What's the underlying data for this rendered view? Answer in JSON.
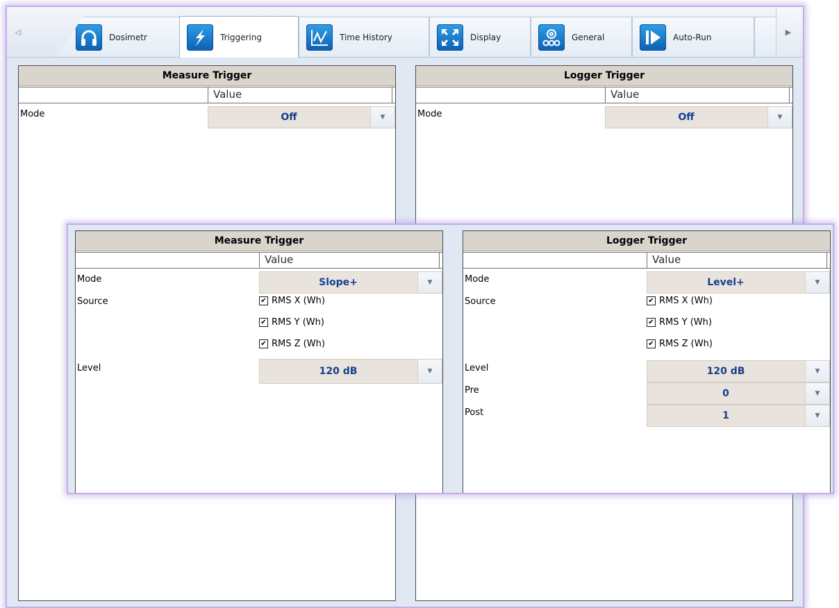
{
  "tabs": [
    {
      "label": "Dosimetr",
      "icon": "headphones-icon"
    },
    {
      "label": "Triggering",
      "icon": "lightning-icon",
      "active": true
    },
    {
      "label": "Time History",
      "icon": "line-chart-icon"
    },
    {
      "label": "Display",
      "icon": "expand-arrows-icon"
    },
    {
      "label": "General",
      "icon": "gears-icon"
    },
    {
      "label": "Auto-Run",
      "icon": "play-icon"
    }
  ],
  "back_panel": {
    "measure": {
      "title": "Measure Trigger",
      "value_header": "Value",
      "mode_label": "Mode",
      "mode_value": "Off"
    },
    "logger": {
      "title": "Logger Trigger",
      "value_header": "Value",
      "mode_label": "Mode",
      "mode_value": "Off"
    }
  },
  "front_panel": {
    "measure": {
      "title": "Measure Trigger",
      "value_header": "Value",
      "mode_label": "Mode",
      "mode_value": "Slope+",
      "source_label": "Source",
      "sources": [
        "RMS X (Wh)",
        "RMS Y (Wh)",
        "RMS Z (Wh)"
      ],
      "level_label": "Level",
      "level_value": "120 dB"
    },
    "logger": {
      "title": "Logger Trigger",
      "value_header": "Value",
      "mode_label": "Mode",
      "mode_value": "Level+",
      "source_label": "Source",
      "sources": [
        "RMS X (Wh)",
        "RMS Y (Wh)",
        "RMS Z (Wh)"
      ],
      "level_label": "Level",
      "level_value": "120 dB",
      "pre_label": "Pre",
      "pre_value": "0",
      "post_label": "Post",
      "post_value": "1"
    }
  },
  "colors": {
    "accent": "#173f8f",
    "panel_header": "#d9d4cc",
    "frame_glow": "#c3aee6"
  }
}
